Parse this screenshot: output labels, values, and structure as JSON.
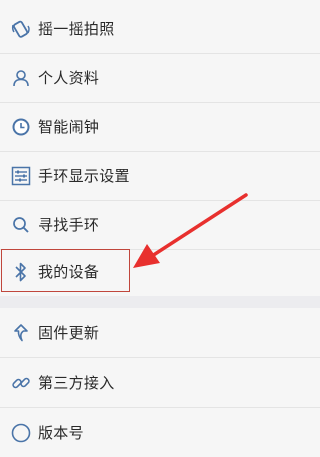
{
  "menu": {
    "items": [
      {
        "label": "摇一摇拍照",
        "icon": "shake-camera-icon"
      },
      {
        "label": "个人资料",
        "icon": "person-icon"
      },
      {
        "label": "智能闹钟",
        "icon": "clock-icon"
      },
      {
        "label": "手环显示设置",
        "icon": "sliders-icon"
      },
      {
        "label": "寻找手环",
        "icon": "search-icon"
      },
      {
        "label": "我的设备",
        "icon": "bluetooth-icon"
      },
      {
        "label": "固件更新",
        "icon": "update-arrow-icon"
      },
      {
        "label": "第三方接入",
        "icon": "link-icon"
      },
      {
        "label": "版本号",
        "icon": "info-icon"
      }
    ]
  },
  "colors": {
    "icon_blue": "#4a74a8",
    "highlight_red": "#c0463c",
    "arrow_red": "#e8302e"
  }
}
